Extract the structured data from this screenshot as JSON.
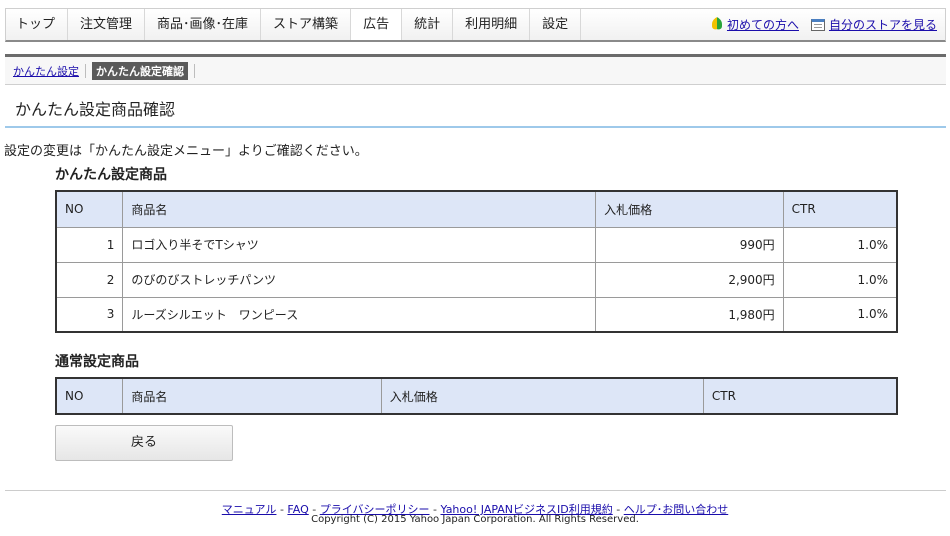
{
  "nav": {
    "tabs": [
      "トップ",
      "注文管理",
      "商品･画像･在庫",
      "ストア構築",
      "広告",
      "統計",
      "利用明細",
      "設定"
    ],
    "beginner_link": "初めての方へ",
    "store_link": "自分のストアを見る"
  },
  "breadcrumb": {
    "link": "かんたん設定",
    "current": "かんたん設定確認"
  },
  "page": {
    "title": "かんたん設定商品確認",
    "intro": "設定の変更は「かんたん設定メニュー」よりご確認ください。"
  },
  "easy_section": {
    "title": "かんたん設定商品",
    "headers": [
      "NO",
      "商品名",
      "入札価格",
      "CTR"
    ],
    "rows": [
      {
        "no": "1",
        "name": "ロゴ入り半そでTシャツ",
        "price": "990円",
        "ctr": "1.0%"
      },
      {
        "no": "2",
        "name": "のびのびストレッチパンツ",
        "price": "2,900円",
        "ctr": "1.0%"
      },
      {
        "no": "3",
        "name": "ルーズシルエット　ワンピース",
        "price": "1,980円",
        "ctr": "1.0%"
      }
    ]
  },
  "normal_section": {
    "title": "通常設定商品",
    "headers": [
      "NO",
      "商品名",
      "入札価格",
      "CTR"
    ]
  },
  "back_button": "戻る",
  "footer": {
    "links": [
      "マニュアル",
      "FAQ",
      "プライバシーポリシー",
      "Yahoo! JAPANビジネスID利用規約",
      "ヘルプ･お問い合わせ"
    ],
    "separator": "-",
    "copyright": "Copyright (C) 2015 Yahoo Japan Corporation. All Rights Reserved."
  }
}
